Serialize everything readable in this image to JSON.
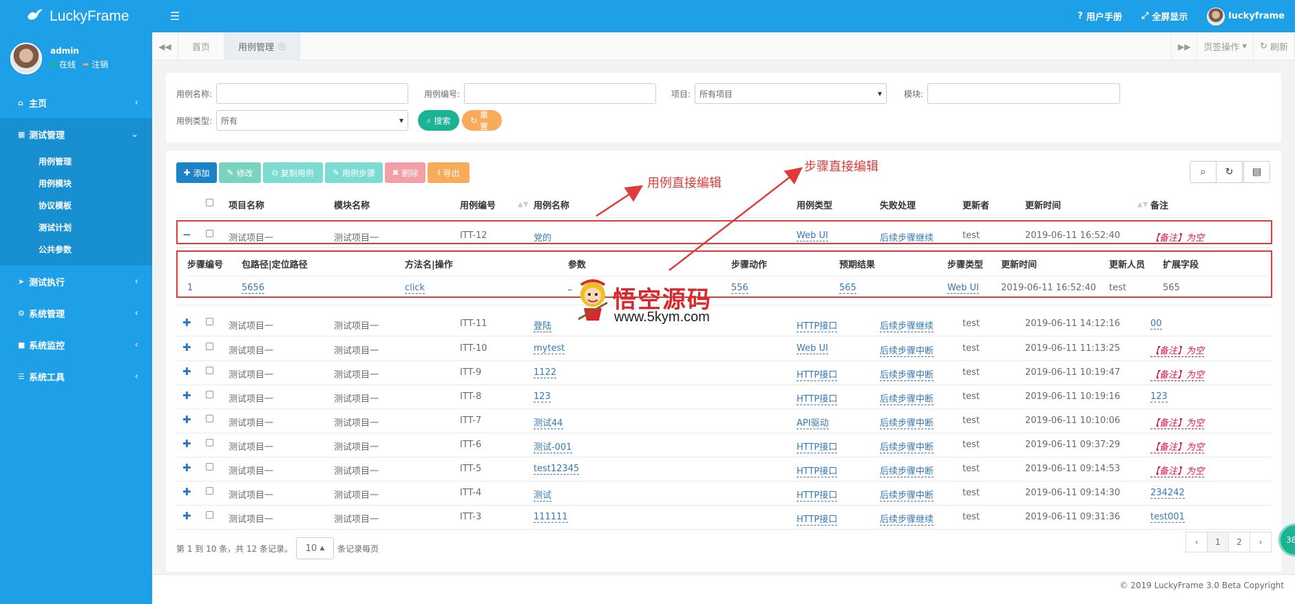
{
  "app": {
    "logo_text": "LuckyFrame"
  },
  "user": {
    "name": "admin",
    "status": "在线",
    "logout": "注销"
  },
  "topbar": {
    "manual": "用户手册",
    "fullscreen": "全屏显示",
    "username": "luckyframe"
  },
  "sidebar": {
    "items": [
      {
        "label": "主页"
      },
      {
        "label": "测试管理"
      },
      {
        "label": "测试执行"
      },
      {
        "label": "系统管理"
      },
      {
        "label": "系统监控"
      },
      {
        "label": "系统工具"
      }
    ],
    "sub_items": [
      "用例管理",
      "用例模块",
      "协议模板",
      "测试计划",
      "公共参数"
    ]
  },
  "tabs": {
    "home": "首页",
    "current": "用例管理",
    "page_ops": "页签操作",
    "refresh": "刷新"
  },
  "search": {
    "case_name_label": "用例名称:",
    "case_no_label": "用例编号:",
    "project_label": "项目:",
    "project_value": "所有项目",
    "module_label": "模块:",
    "case_type_label": "用例类型:",
    "case_type_value": "所有",
    "search_btn": "搜索",
    "reset_btn": "重置"
  },
  "toolbar": {
    "add": "添加",
    "edit": "修改",
    "copy": "复制用例",
    "steps": "用例步骤",
    "delete": "删除",
    "export": "导出"
  },
  "table": {
    "headers": [
      "项目名称",
      "模块名称",
      "用例编号",
      "用例名称",
      "用例类型",
      "失败处理",
      "更新者",
      "更新时间",
      "备注"
    ],
    "rows": [
      {
        "project": "测试项目一",
        "module": "测试项目一",
        "no": "ITT-12",
        "name": "党的",
        "type": "Web UI",
        "fail": "后续步骤继续",
        "updater": "test",
        "time": "2019-06-11 16:52:40",
        "note": "【备注】为空",
        "note_red": true
      },
      {
        "project": "测试项目一",
        "module": "测试项目一",
        "no": "ITT-11",
        "name": "登陆",
        "type": "HTTP接口",
        "fail": "后续步骤继续",
        "updater": "test",
        "time": "2019-06-11 14:12:16",
        "note": "00",
        "note_red": false
      },
      {
        "project": "测试项目一",
        "module": "测试项目一",
        "no": "ITT-10",
        "name": "mytest",
        "type": "Web UI",
        "fail": "后续步骤中断",
        "updater": "test",
        "time": "2019-06-11 11:13:25",
        "note": "【备注】为空",
        "note_red": true
      },
      {
        "project": "测试项目一",
        "module": "测试项目一",
        "no": "ITT-9",
        "name": "1122",
        "type": "HTTP接口",
        "fail": "后续步骤中断",
        "updater": "test",
        "time": "2019-06-11 10:19:47",
        "note": "【备注】为空",
        "note_red": true
      },
      {
        "project": "测试项目一",
        "module": "测试项目一",
        "no": "ITT-8",
        "name": "123",
        "type": "HTTP接口",
        "fail": "后续步骤中断",
        "updater": "test",
        "time": "2019-06-11 10:19:16",
        "note": "123",
        "note_red": false
      },
      {
        "project": "测试项目一",
        "module": "测试项目一",
        "no": "ITT-7",
        "name": "测试44",
        "type": "API驱动",
        "fail": "后续步骤中断",
        "updater": "test",
        "time": "2019-06-11 10:10:06",
        "note": "【备注】为空",
        "note_red": true
      },
      {
        "project": "测试项目一",
        "module": "测试项目一",
        "no": "ITT-6",
        "name": "测试-001",
        "type": "HTTP接口",
        "fail": "后续步骤中断",
        "updater": "test",
        "time": "2019-06-11 09:37:29",
        "note": "【备注】为空",
        "note_red": true
      },
      {
        "project": "测试项目一",
        "module": "测试项目一",
        "no": "ITT-5",
        "name": "test12345",
        "type": "HTTP接口",
        "fail": "后续步骤中断",
        "updater": "test",
        "time": "2019-06-11 09:14:53",
        "note": "【备注】为空",
        "note_red": true
      },
      {
        "project": "测试项目一",
        "module": "测试项目一",
        "no": "ITT-4",
        "name": "测试",
        "type": "HTTP接口",
        "fail": "后续步骤中断",
        "updater": "test",
        "time": "2019-06-11 09:14:30",
        "note": "234242",
        "note_red": false
      },
      {
        "project": "测试项目一",
        "module": "测试项目一",
        "no": "ITT-3",
        "name": "111111",
        "type": "HTTP接口",
        "fail": "后续步骤继续",
        "updater": "test",
        "time": "2019-06-11 09:31:36",
        "note": "test001",
        "note_red": false
      }
    ]
  },
  "steps": {
    "headers": [
      "步骤编号",
      "包路径|定位路径",
      "方法名|操作",
      "参数",
      "步骤动作",
      "预期结果",
      "步骤类型",
      "更新时间",
      "更新人员",
      "扩展字段"
    ],
    "row": {
      "no": "1",
      "path": "5656",
      "method": "click",
      "param": "",
      "action": "556",
      "expect": "565",
      "type": "Web UI",
      "time": "2019-06-11 16:52:40",
      "updater": "test",
      "ext": "565"
    }
  },
  "annotations": {
    "case_edit": "用例直接编辑",
    "step_edit": "步骤直接编辑"
  },
  "pager": {
    "summary": "第 1 到 10 条，共 12 条记录。",
    "page_size": "10",
    "per_page_suffix": "条记录每页",
    "pages": [
      "‹",
      "1",
      "2",
      "›"
    ]
  },
  "footer": {
    "copyright": "© 2019 LuckyFrame 3.0 Beta Copyright"
  },
  "watermark": {
    "title": "悟空源码",
    "url": "www.5kym.com"
  },
  "float_badge": "38",
  "colors": {
    "primary": "#1ea0e8",
    "success": "#1ab394",
    "warning": "#f8ac59",
    "danger": "#e03b3b",
    "link": "#337ab7"
  }
}
